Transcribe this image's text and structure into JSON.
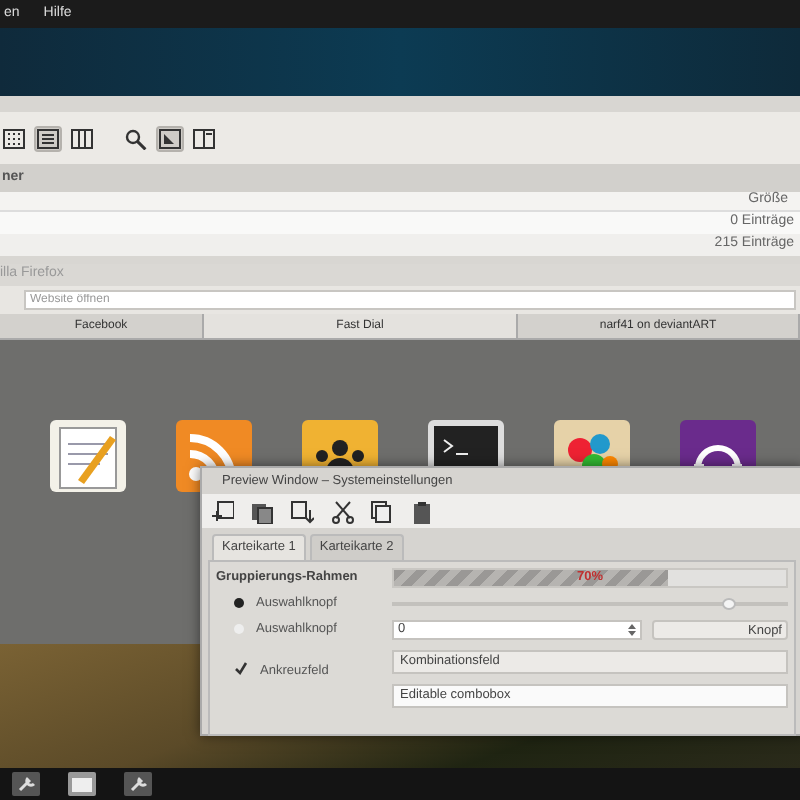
{
  "menubar": {
    "items": [
      "en",
      "Hilfe"
    ]
  },
  "file_manager": {
    "toolbar": [
      {
        "kind": "icons",
        "selected": false
      },
      {
        "kind": "list",
        "selected": true
      },
      {
        "kind": "columns",
        "selected": false
      },
      {
        "kind": "search",
        "selected": false
      },
      {
        "kind": "preview",
        "selected": true
      },
      {
        "kind": "pane",
        "selected": false
      }
    ],
    "location": "ner",
    "columns": [
      "Größe"
    ],
    "rows": [
      {
        "size": "0 Einträge"
      },
      {
        "size": "215 Einträge"
      }
    ]
  },
  "browser": {
    "title": "illa Firefox",
    "address": {
      "placeholder": "Website öffnen"
    },
    "tabs": [
      {
        "label": "Facebook",
        "selected": false
      },
      {
        "label": "Fast Dial",
        "selected": true
      },
      {
        "label": "narf41 on deviantART",
        "selected": false
      }
    ],
    "tiles": [
      {
        "kind": "notes"
      },
      {
        "kind": "rss"
      },
      {
        "kind": "people"
      },
      {
        "kind": "terminal"
      },
      {
        "kind": "paint"
      },
      {
        "kind": "audio"
      }
    ]
  },
  "dialog": {
    "title": "Preview Window – Systemeinstellungen",
    "tabs": [
      {
        "label": "Karteikarte 1",
        "selected": true
      },
      {
        "label": "Karteikarte 2",
        "selected": false
      }
    ],
    "group_title": "Gruppierungs-Rahmen",
    "radios": [
      {
        "label": "Auswahlknopf",
        "selected": true
      },
      {
        "label": "Auswahlknopf",
        "selected": false
      }
    ],
    "checkbox": {
      "label": "Ankreuzfeld",
      "checked": true
    },
    "progress": {
      "label": "70%",
      "level": 0.7
    },
    "slider": {
      "level": 0.85
    },
    "spin": {
      "value": "0"
    },
    "button": "Knopf",
    "combo": {
      "value": "Kombinationsfeld"
    },
    "editable_combo": {
      "value": "Editable combobox"
    }
  }
}
